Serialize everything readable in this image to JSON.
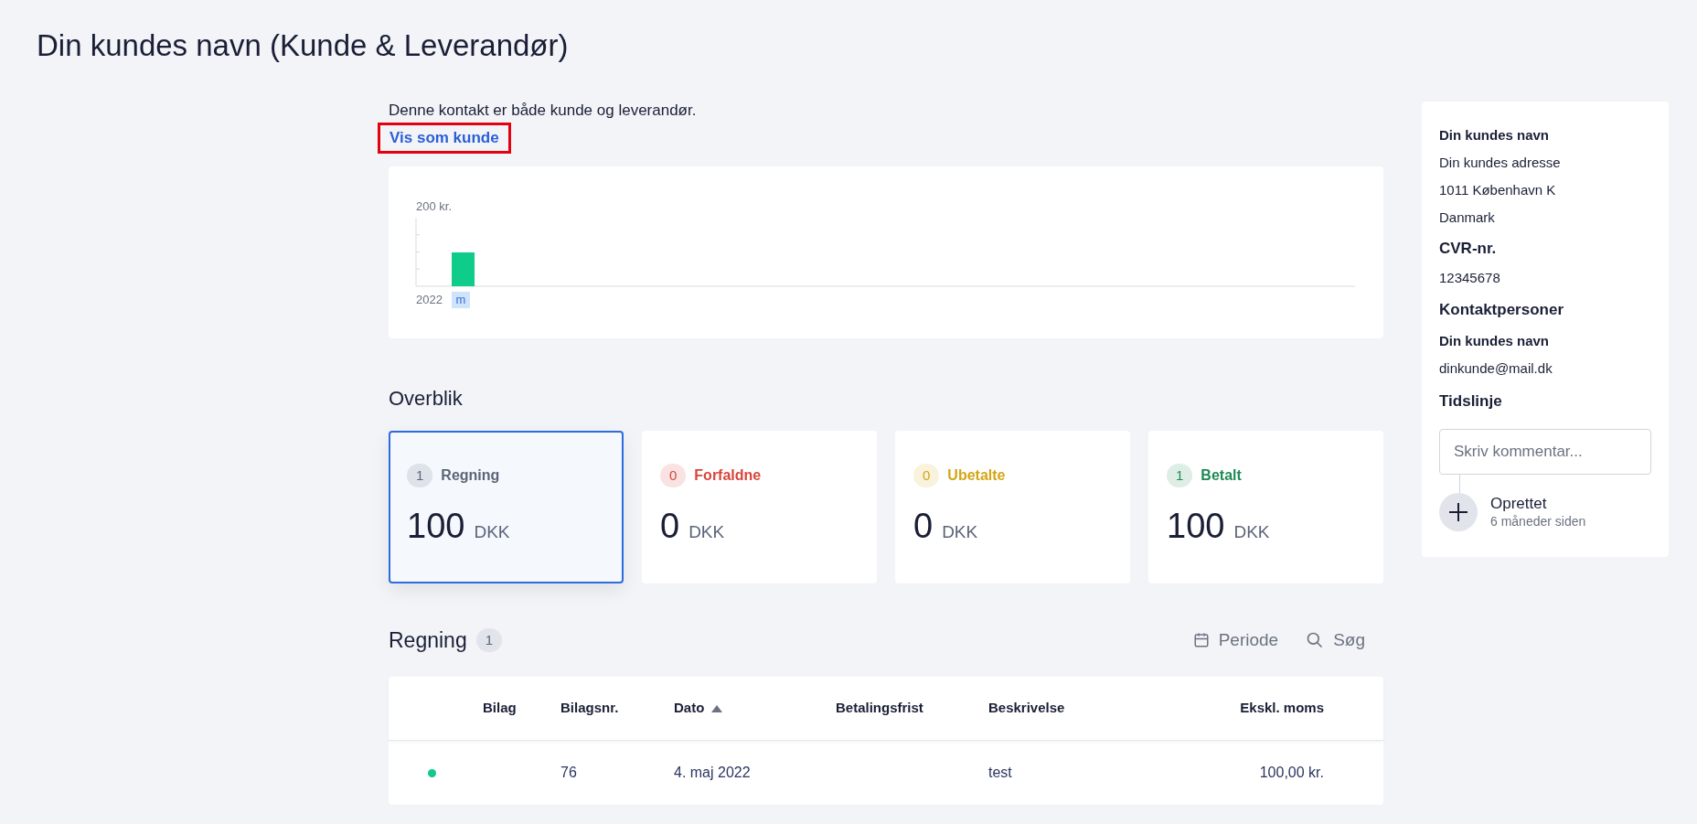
{
  "page": {
    "title": "Din kundes navn (Kunde & Leverandør)"
  },
  "notice": {
    "text": "Denne kontakt er både kunde og leverandør.",
    "link": "Vis som kunde",
    "highlighted": true
  },
  "revenue_chart": {
    "axis_label": "200 kr.",
    "year": "2022",
    "period": "m"
  },
  "overview": {
    "title": "Overblik",
    "cards": [
      {
        "count": "1",
        "label": "Regning",
        "amount": "100",
        "currency": "DKK",
        "color": "#5b6478",
        "selected": true
      },
      {
        "count": "0",
        "label": "Forfaldne",
        "amount": "0",
        "currency": "DKK",
        "color": "#d9453a",
        "selected": false
      },
      {
        "count": "0",
        "label": "Ubetalte",
        "amount": "0",
        "currency": "DKK",
        "color": "#d4a514",
        "selected": false
      },
      {
        "count": "1",
        "label": "Betalt",
        "amount": "100",
        "currency": "DKK",
        "color": "#1f8a55",
        "selected": false
      }
    ]
  },
  "bills": {
    "title": "Regning",
    "count": "1",
    "actions": [
      {
        "kind": "period",
        "label": "Periode"
      },
      {
        "kind": "search",
        "label": "Søg"
      }
    ],
    "columns": [
      {
        "label": "Bilag",
        "sorted": false
      },
      {
        "label": "Bilagsnr.",
        "sorted": false
      },
      {
        "label": "Dato",
        "sorted": true
      },
      {
        "label": "Betalingsfrist",
        "sorted": false
      },
      {
        "label": "Beskrivelse",
        "sorted": false
      },
      {
        "label": "Ekskl. moms",
        "sorted": false
      }
    ],
    "rows": [
      {
        "color": "#10c98a",
        "cells": [
          "",
          "76",
          "4. maj 2022",
          "",
          "test",
          "100,00 kr."
        ]
      }
    ]
  },
  "sidebar": {
    "name": "Din kundes navn",
    "address_lines": [
      "Din kundes adresse",
      "1011 København K",
      "Danmark"
    ],
    "cvr_heading": "CVR-nr.",
    "cvr": "12345678",
    "contacts_heading": "Kontaktpersoner",
    "contacts": [
      {
        "name": "Din kundes navn",
        "email": "dinkunde@mail.dk"
      }
    ],
    "timeline_heading": "Tidslinje",
    "comment_placeholder": "Skriv kommentar...",
    "events": [
      {
        "title": "Oprettet",
        "time": "6 måneder siden"
      }
    ]
  }
}
